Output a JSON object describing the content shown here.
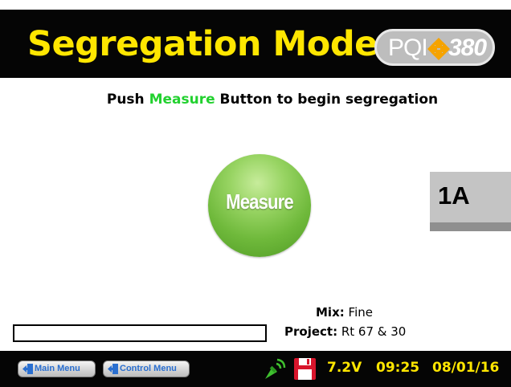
{
  "header": {
    "title": "Segregation Mode",
    "logo": {
      "prefix": "PQI",
      "model": "380",
      "icon": "arrows-logo-icon"
    }
  },
  "instruction": {
    "prefix": "Push ",
    "highlight": "Measure",
    "suffix": " Button to begin segregation",
    "highlight_color": "#22d12f"
  },
  "measure_button": {
    "label": "Measure",
    "color": "#6fb93b"
  },
  "lane": {
    "label": "1A"
  },
  "info": {
    "mix_label": "Mix:",
    "mix_value": "Fine",
    "project_label": "Project:",
    "project_value": "Rt 67 & 30"
  },
  "progress": {
    "value": 0
  },
  "footer": {
    "main_menu_label": "Main Menu",
    "control_menu_label": "Control Menu",
    "menu_icon": "exit-door-icon",
    "signal_icon": "satellite-signal-icon",
    "save_icon": "floppy-disk-icon",
    "voltage": "7.2V",
    "time": "09:25",
    "date": "08/01/16",
    "status_color": "#ffe600"
  },
  "colors": {
    "title": "#ffe600",
    "background": "#050505"
  }
}
